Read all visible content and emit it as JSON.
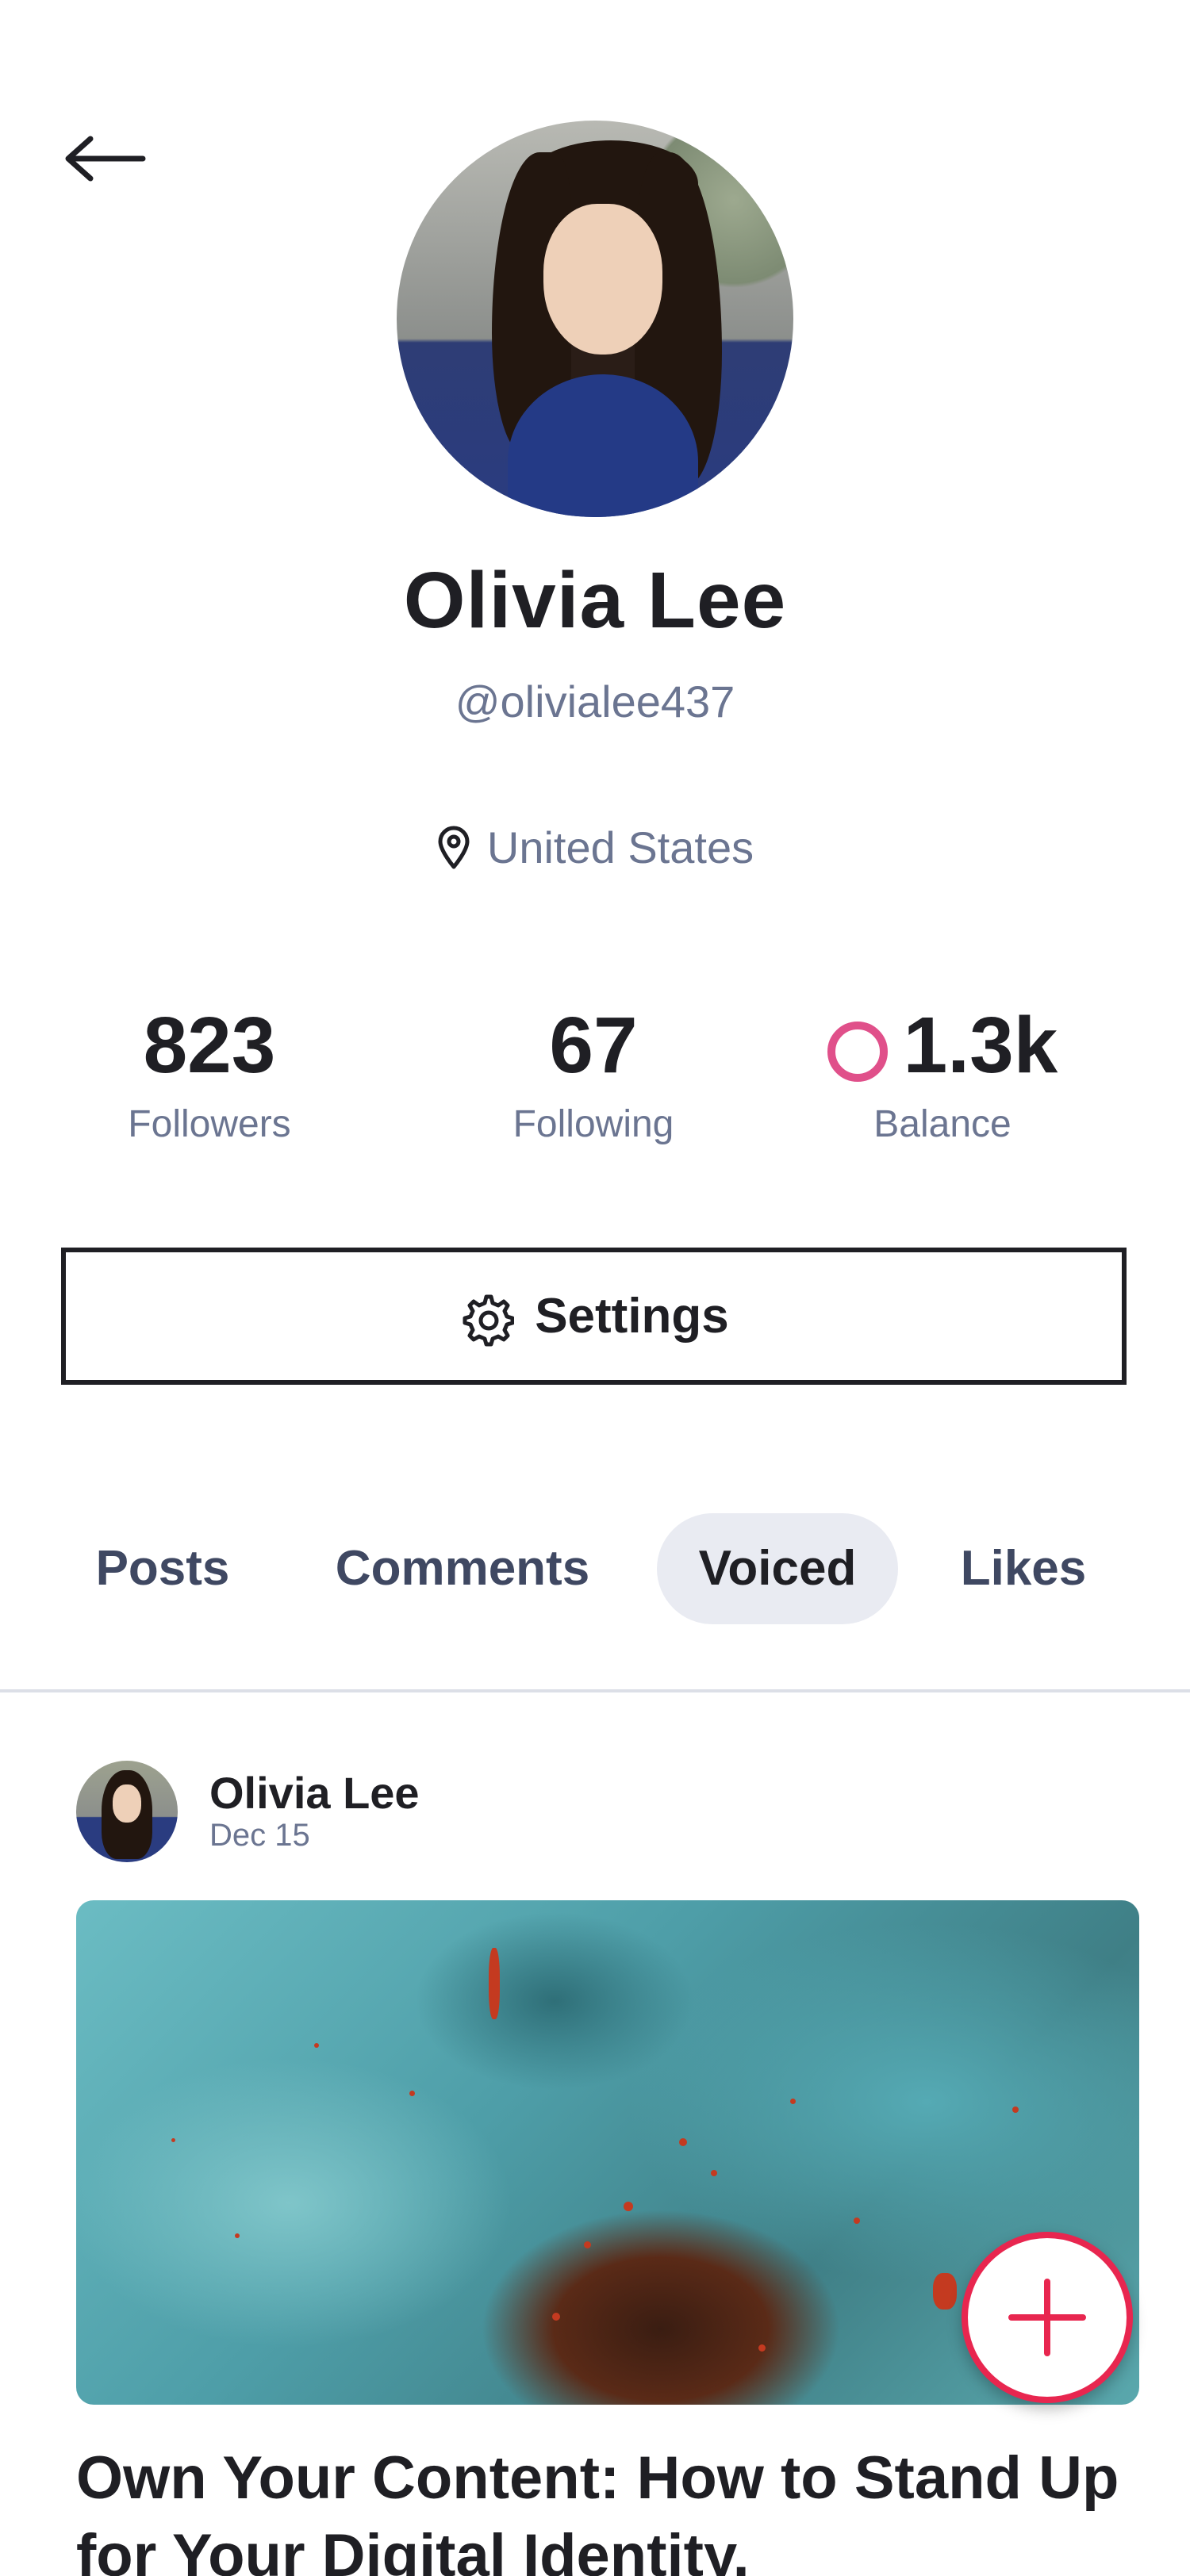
{
  "header": {
    "back_icon": "arrow-left-icon"
  },
  "profile": {
    "name": "Olivia Lee",
    "handle": "@olivialee437",
    "location": "United States",
    "location_icon": "map-pin-icon"
  },
  "stats": {
    "followers": {
      "value": "823",
      "label": "Followers"
    },
    "following": {
      "value": "67",
      "label": "Following"
    },
    "balance": {
      "value": "1.3k",
      "label": "Balance",
      "icon": "coin-ring-icon"
    }
  },
  "settings": {
    "label": "Settings",
    "icon": "gear-icon"
  },
  "tabs": [
    {
      "label": "Posts",
      "active": false
    },
    {
      "label": "Comments",
      "active": false
    },
    {
      "label": "Voiced",
      "active": true
    },
    {
      "label": "Likes",
      "active": false
    }
  ],
  "post": {
    "author": "Olivia Lee",
    "date": "Dec 15",
    "title": "Own Your Content: How to Stand Up for Your Digital Identity."
  },
  "fab": {
    "icon": "plus-icon"
  },
  "colors": {
    "text_primary": "#1f1f24",
    "text_secondary": "#6b7591",
    "tab_active_bg": "#e9ebf2",
    "accent_red": "#e8264f",
    "coin_ring": "#e0508a"
  }
}
